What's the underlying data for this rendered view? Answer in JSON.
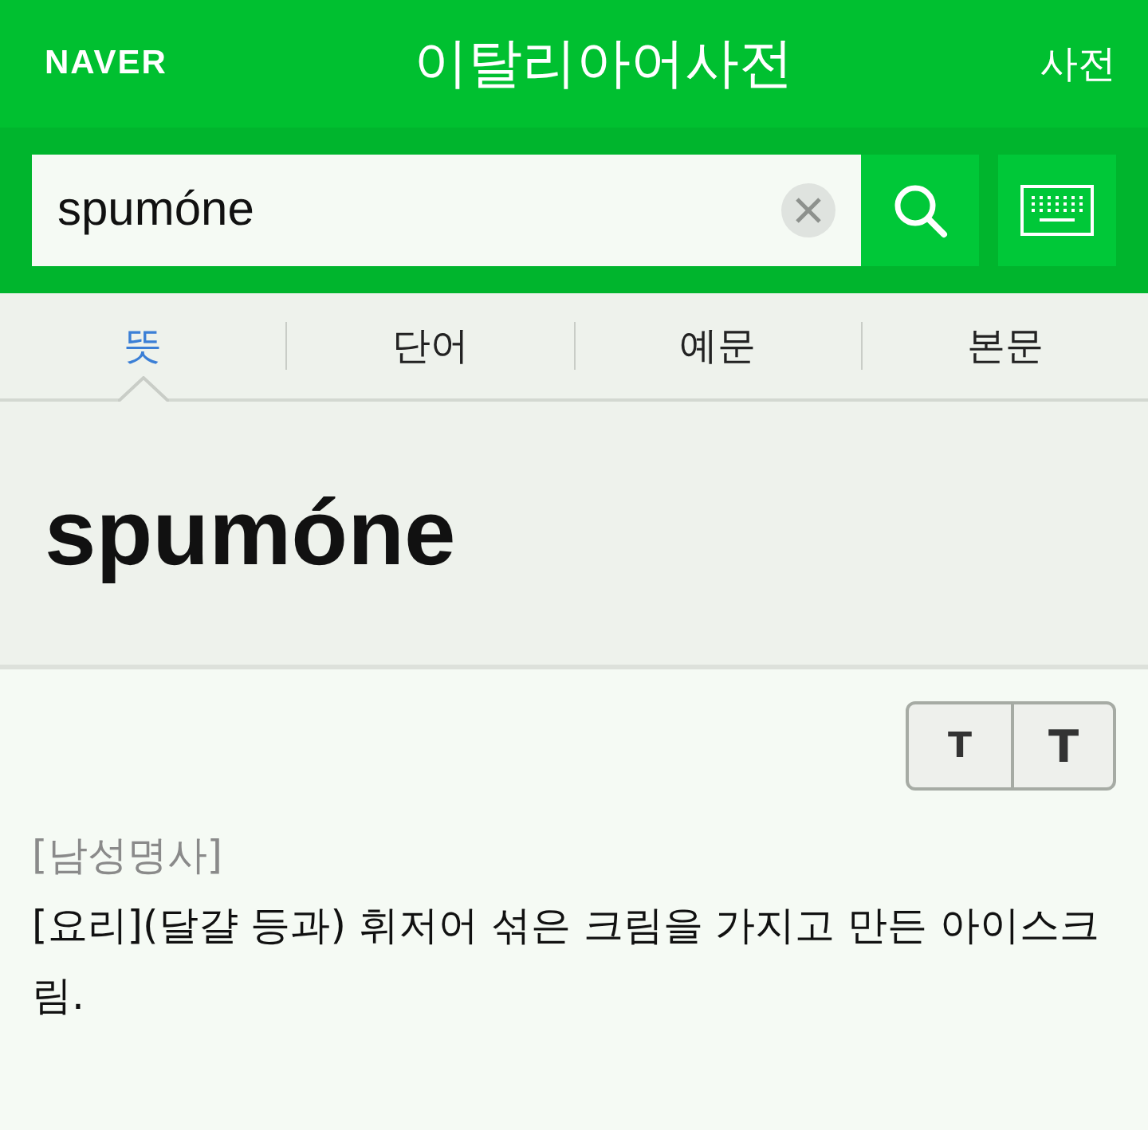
{
  "header": {
    "logo": "NAVER",
    "title": "이탈리아어사전",
    "link": "사전"
  },
  "search": {
    "value": "spumóne"
  },
  "tabs": [
    {
      "label": "뜻",
      "selected": true
    },
    {
      "label": "단어",
      "selected": false
    },
    {
      "label": "예문",
      "selected": false
    },
    {
      "label": "본문",
      "selected": false
    }
  ],
  "entry": {
    "headword": "spumóne"
  },
  "font_size_buttons": [
    "T",
    "T"
  ],
  "definition": {
    "part_of_speech": "[남성명사]",
    "text": "[요리](달걀 등과) 휘저어 섞은 크림을 가지고 만든 아이스크림."
  }
}
